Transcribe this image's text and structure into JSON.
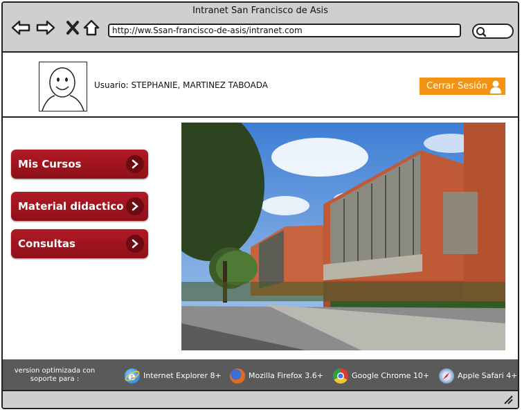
{
  "window": {
    "title": "Intranet San Francisco de Asis"
  },
  "browser": {
    "url": "http://ww.Ssan-francisco-de-asis/intranet.com"
  },
  "header": {
    "user_label": "Usuario: STEPHANIE, MARTINEZ TABOADA",
    "logout_label": "Cerrar Sesión",
    "accent_color": "#f39314"
  },
  "menu": {
    "items": [
      {
        "label": "Mis Cursos"
      },
      {
        "label": "Material didactico"
      },
      {
        "label": "Consultas"
      }
    ],
    "button_color": "#a3141f"
  },
  "footer": {
    "note": "version optimizada con soporte para :",
    "browsers": [
      {
        "label": "Internet Explorer 8+",
        "icon": "internet-explorer-icon"
      },
      {
        "label": "Mozilla Firefox 3.6+",
        "icon": "firefox-icon"
      },
      {
        "label": "Google Chrome 10+",
        "icon": "chrome-icon"
      },
      {
        "label": "Apple Safari 4+",
        "icon": "safari-icon"
      }
    ]
  }
}
